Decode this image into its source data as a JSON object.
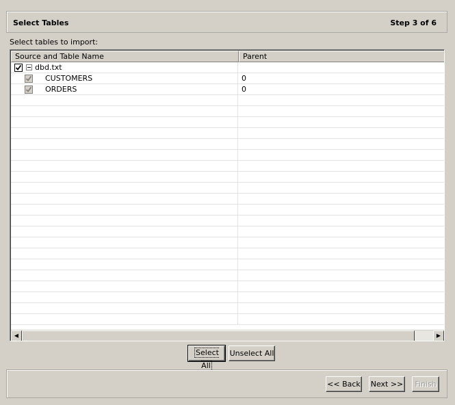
{
  "header": {
    "title": "Select Tables",
    "step": "Step 3 of 6"
  },
  "instruction": "Select tables to import:",
  "table": {
    "columns": [
      "Source and Table Name",
      "Parent"
    ],
    "rows": [
      {
        "name": "dbd.txt",
        "parent": "",
        "level": 0,
        "checked": true,
        "expanded": true
      },
      {
        "name": "CUSTOMERS",
        "parent": "0",
        "level": 1,
        "checked": true
      },
      {
        "name": "ORDERS",
        "parent": "0",
        "level": 1,
        "checked": true
      }
    ]
  },
  "buttons": {
    "select_all": "Select All",
    "unselect_all": "Unselect All",
    "back": "<< Back",
    "next": "Next >>",
    "finish": "Finish"
  }
}
